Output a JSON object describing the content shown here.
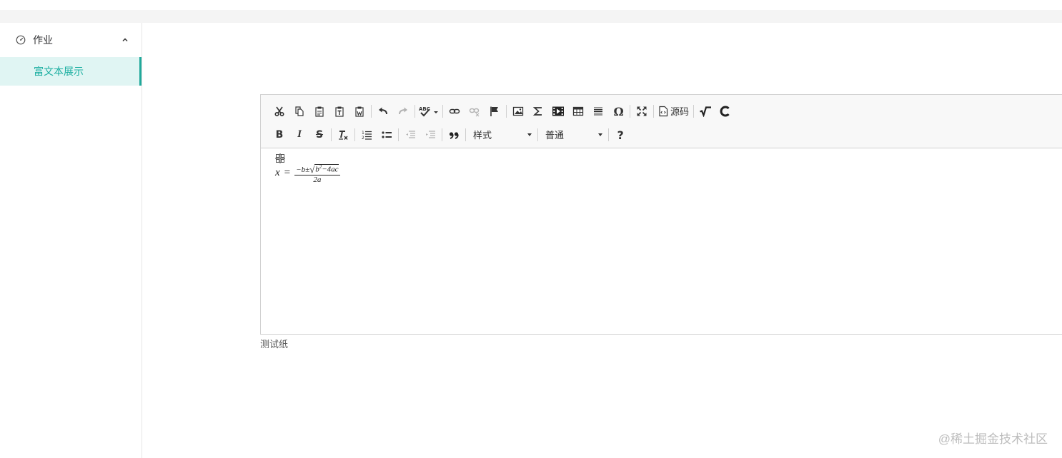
{
  "sidebar": {
    "group": {
      "label": "作业",
      "icon": "dashboard-icon",
      "expanded": true
    },
    "items": [
      {
        "label": "富文本展示",
        "active": true
      }
    ]
  },
  "editor": {
    "toolbar": {
      "source_label": "源码",
      "styles_combo": "样式",
      "format_combo": "普通"
    },
    "content": {
      "formula": {
        "lhs": "x",
        "eq": "=",
        "numerator_prefix": "−b±",
        "radical": "√",
        "radicand_base": "b",
        "radicand_exp": "2",
        "radicand_rest": "−4ac",
        "denominator": "2a"
      }
    }
  },
  "caption": "测试纸",
  "watermark": "@稀土掘金技术社区",
  "colors": {
    "accent": "#20a99b",
    "active_bg": "#e0f5f3",
    "toolbar_bg": "#f8f8f8",
    "border": "#d1d1d1"
  }
}
